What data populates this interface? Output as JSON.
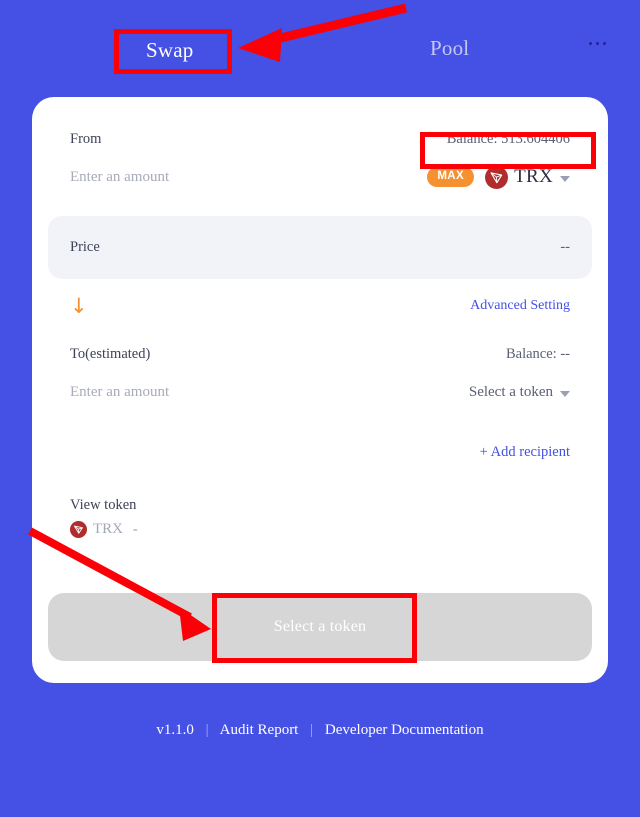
{
  "nav": {
    "tabs": [
      {
        "label": "Swap",
        "active": true
      },
      {
        "label": "Pool",
        "active": false
      }
    ],
    "overflow_icon": "more-horizontal-icon"
  },
  "swap_card": {
    "from": {
      "label": "From",
      "balance_label": "Balance: 513.604406",
      "amount_placeholder": "Enter an amount",
      "max_label": "MAX",
      "token_symbol": "TRX",
      "token_icon": "trx-token-icon",
      "caret_icon": "chevron-down-icon"
    },
    "price": {
      "label": "Price",
      "value": "--"
    },
    "middle": {
      "direction_arrow": "↓",
      "advanced_setting_label": "Advanced Setting"
    },
    "to": {
      "label": "To(estimated)",
      "balance_label": "Balance: --",
      "amount_placeholder": "Enter an amount",
      "token_select_label": "Select a token",
      "caret_icon": "chevron-down-icon"
    },
    "add_recipient_label": "+ Add recipient",
    "view_token": {
      "title": "View token",
      "token_icon": "trx-token-icon",
      "token_symbol": "TRX",
      "value": "-"
    },
    "submit_label": "Select a token"
  },
  "footer": {
    "version": "v1.1.0",
    "separator": "|",
    "audit_report": "Audit Report",
    "developer_documentation": "Developer Documentation"
  },
  "colors": {
    "page_background": "#4550E5",
    "card_background": "#FFFFFF",
    "panel_grey": "#F2F3F8",
    "accent_link": "#4550E5",
    "max_badge": "#F59131",
    "arrow_orange": "#F59131",
    "trx_red": "#B02D2D",
    "submit_disabled": "#D6D6D6",
    "annotation_red": "#FB0007"
  }
}
